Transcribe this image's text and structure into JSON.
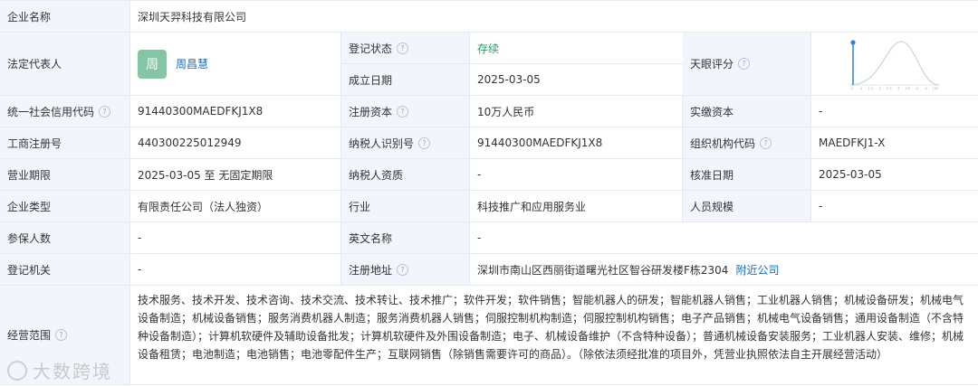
{
  "company": {
    "name_label": "企业名称",
    "name_value": "深圳天羿科技有限公司"
  },
  "legal": {
    "label": "法定代表人",
    "avatar_char": "周",
    "name": "周昌慧",
    "reg_status_label": "登记状态",
    "reg_status_value": "存续",
    "found_date_label": "成立日期",
    "found_date_value": "2025-03-05",
    "rating_label": "天眼评分",
    "chart_ticks": [
      "0",
      "1",
      "1.5",
      "2",
      "2.5",
      "3",
      "3.5",
      "4",
      "5",
      "100"
    ]
  },
  "credit": {
    "label": "统一社会信用代码",
    "value": "91440300MAEDFKJ1X8",
    "capital_label": "注册资本",
    "capital_value": "10万人民币",
    "paid_label": "实缴资本",
    "paid_value": "-"
  },
  "biz_reg": {
    "label": "工商注册号",
    "value": "440300225012949",
    "tax_label": "纳税人识别号",
    "tax_value": "91440300MAEDFKJ1X8",
    "org_label": "组织机构代码",
    "org_value": "MAEDFKJ1-X"
  },
  "term": {
    "label": "营业期限",
    "value": "2025-03-05 至 无固定期限",
    "taxpayer_label": "纳税人资质",
    "taxpayer_value": "-",
    "approve_label": "核准日期",
    "approve_value": "2025-03-05"
  },
  "type": {
    "label": "企业类型",
    "value": "有限责任公司（法人独资）",
    "industry_label": "行业",
    "industry_value": "科技推广和应用服务业",
    "staff_label": "人员规模",
    "staff_value": "-"
  },
  "insured": {
    "label": "参保人数",
    "value": "-",
    "en_label": "英文名称",
    "en_value": "-"
  },
  "authority": {
    "label": "登记机关",
    "value": "-",
    "addr_label": "注册地址",
    "addr_value": "深圳市南山区西丽街道曙光社区智谷研发楼F栋2304",
    "nearby_link": "附近公司"
  },
  "scope": {
    "label": "经营范围",
    "value": "技术服务、技术开发、技术咨询、技术交流、技术转让、技术推广；软件开发；软件销售；智能机器人的研发；智能机器人销售；工业机器人销售；机械设备研发；机械电气设备制造；机械设备销售；服务消费机器人制造；服务消费机器人销售；伺服控制机构制造；伺服控制机构销售；电子产品销售；机械电气设备销售；通用设备制造（不含特种设备制造）；计算机软硬件及辅助设备批发；计算机软硬件及外围设备制造；电子、机械设备维护（不含特种设备）；普通机械设备安装服务；工业机器人安装、维修；机械设备租赁；电池制造；电池销售；电池零配件生产；互联网销售（除销售需要许可的商品）。（除依法须经批准的项目外，凭营业执照依法自主开展经营活动）"
  },
  "watermark": "大数跨境",
  "help_glyph": "?"
}
